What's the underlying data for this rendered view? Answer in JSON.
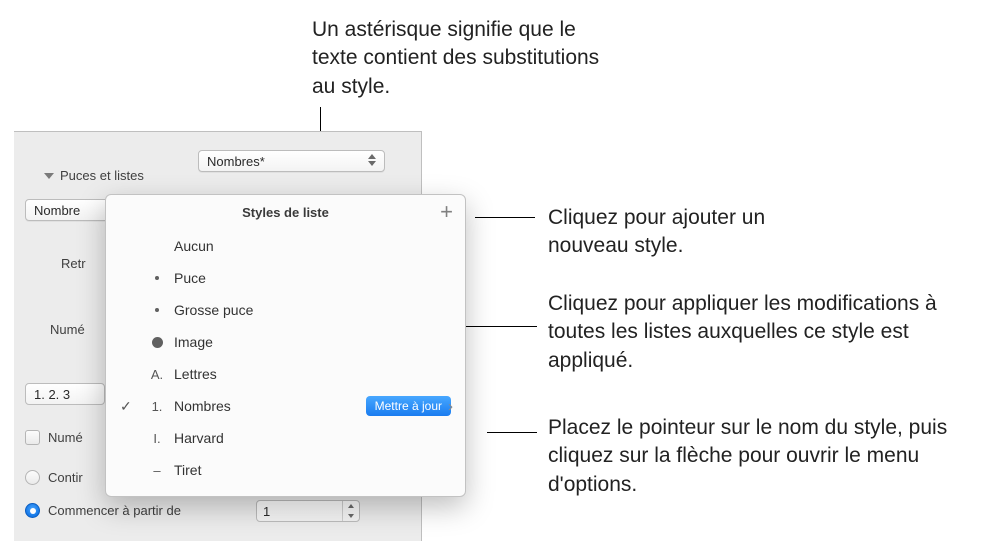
{
  "callouts": {
    "asterisk": "Un astérisque signifie que le texte contient des substitutions au style.",
    "plus": "Cliquez pour ajouter un nouveau style.",
    "update": "Cliquez pour appliquer les modifications à toutes les listes auxquelles ce style est appliqué.",
    "arrow": "Placez le pointeur sur le nom du style, puis cliquez sur la flèche pour ouvrir le menu d'options."
  },
  "panel": {
    "section_title": "Puces et listes",
    "style_selected": "Nombres*",
    "type_popup_truncated": "Nombre",
    "label_indent": "Retr",
    "label_numeros": "Numé",
    "num_format": "1. 2. 3",
    "checkbox_numb": "Numé",
    "radio_continue": "Contir",
    "radio_start_from": "Commencer à partir de",
    "stepper_value": "1"
  },
  "popover": {
    "title": "Styles de liste",
    "items": [
      {
        "marker": "",
        "label": "Aucun"
      },
      {
        "marker": "dot-sm",
        "label": "Puce"
      },
      {
        "marker": "dot-sm",
        "label": "Grosse puce"
      },
      {
        "marker": "dot-lg",
        "label": "Image"
      },
      {
        "marker": "A.",
        "label": "Lettres"
      },
      {
        "marker": "1.",
        "label": "Nombres",
        "checked": true,
        "update": true,
        "arrow": true
      },
      {
        "marker": "I.",
        "label": "Harvard"
      },
      {
        "marker": "–",
        "label": "Tiret"
      }
    ],
    "update_label": "Mettre à jour",
    "plus": "+"
  }
}
